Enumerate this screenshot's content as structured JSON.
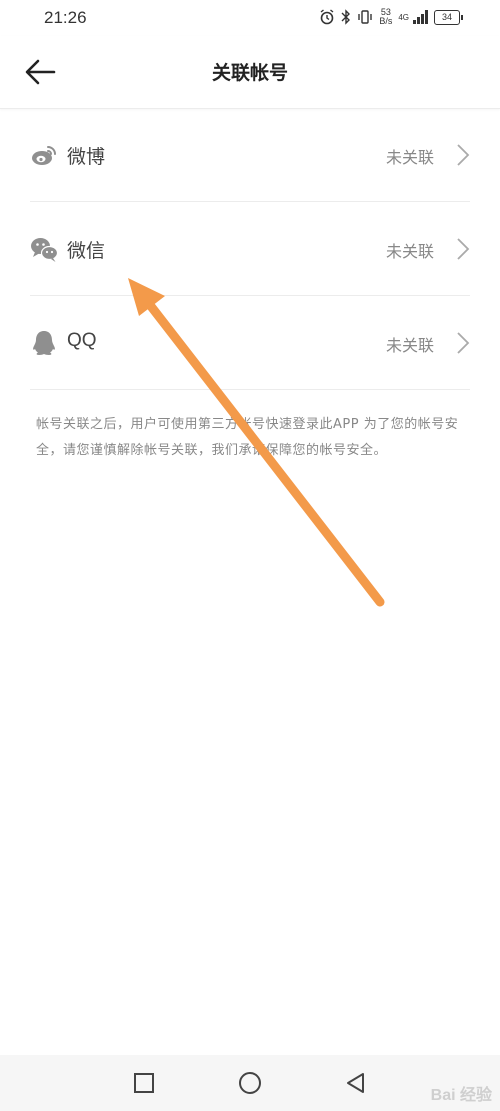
{
  "status_bar": {
    "time": "21:26",
    "speed_top": "53",
    "speed_bottom": "B/s",
    "network": "4G",
    "battery": "34"
  },
  "header": {
    "title": "关联帐号",
    "back_icon": "arrow-left-icon"
  },
  "accounts": [
    {
      "label": "微博",
      "status": "未关联",
      "icon": "weibo-icon"
    },
    {
      "label": "微信",
      "status": "未关联",
      "icon": "wechat-icon"
    },
    {
      "label": "QQ",
      "status": "未关联",
      "icon": "qq-icon"
    }
  ],
  "note": "帐号关联之后，用户可使用第三方帐号快速登录此APP 为了您的帐号安全，请您谨慎解除帐号关联，我们承诺保障您的帐号安全。",
  "nav": {
    "recent_icon": "square-icon",
    "home_icon": "circle-icon",
    "back_icon": "triangle-back-icon"
  },
  "watermark": "Bai 经验",
  "colors": {
    "annotation_arrow": "#f39a4a",
    "divider": "#ececec",
    "secondary_text": "#888888"
  }
}
